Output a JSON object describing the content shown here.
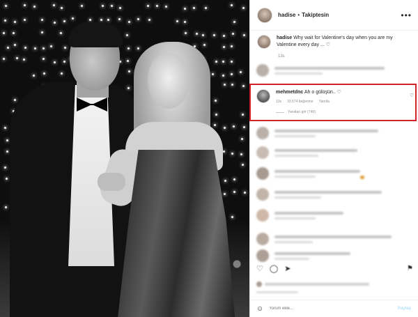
{
  "header": {
    "username": "hadise",
    "separator": "•",
    "follow_state": "Takiptesin",
    "more_icon": "more-horizontal-icon"
  },
  "caption": {
    "username": "hadise",
    "text": "Why wait for Valentine's day when you are my Valentine every day ...",
    "heart": "♡",
    "age": "13s"
  },
  "highlighted_comment": {
    "username": "mehmetdnc",
    "text": "Ah o gülüşün..",
    "heart": "♡",
    "age": "13s",
    "likes": "33.574 beğenme",
    "reply_label": "Yanıtla",
    "view_replies": "Yanıtları gör (740)",
    "highlight_color": "#d2232a"
  },
  "actions": {
    "like_icon": "heart-icon",
    "comment_icon": "comment-icon",
    "share_icon": "share-icon",
    "save_icon": "bookmark-icon"
  },
  "comment_bar": {
    "emoji_icon": "smile-icon",
    "placeholder": "Yorum ekle...",
    "post_label": "Paylaş"
  }
}
